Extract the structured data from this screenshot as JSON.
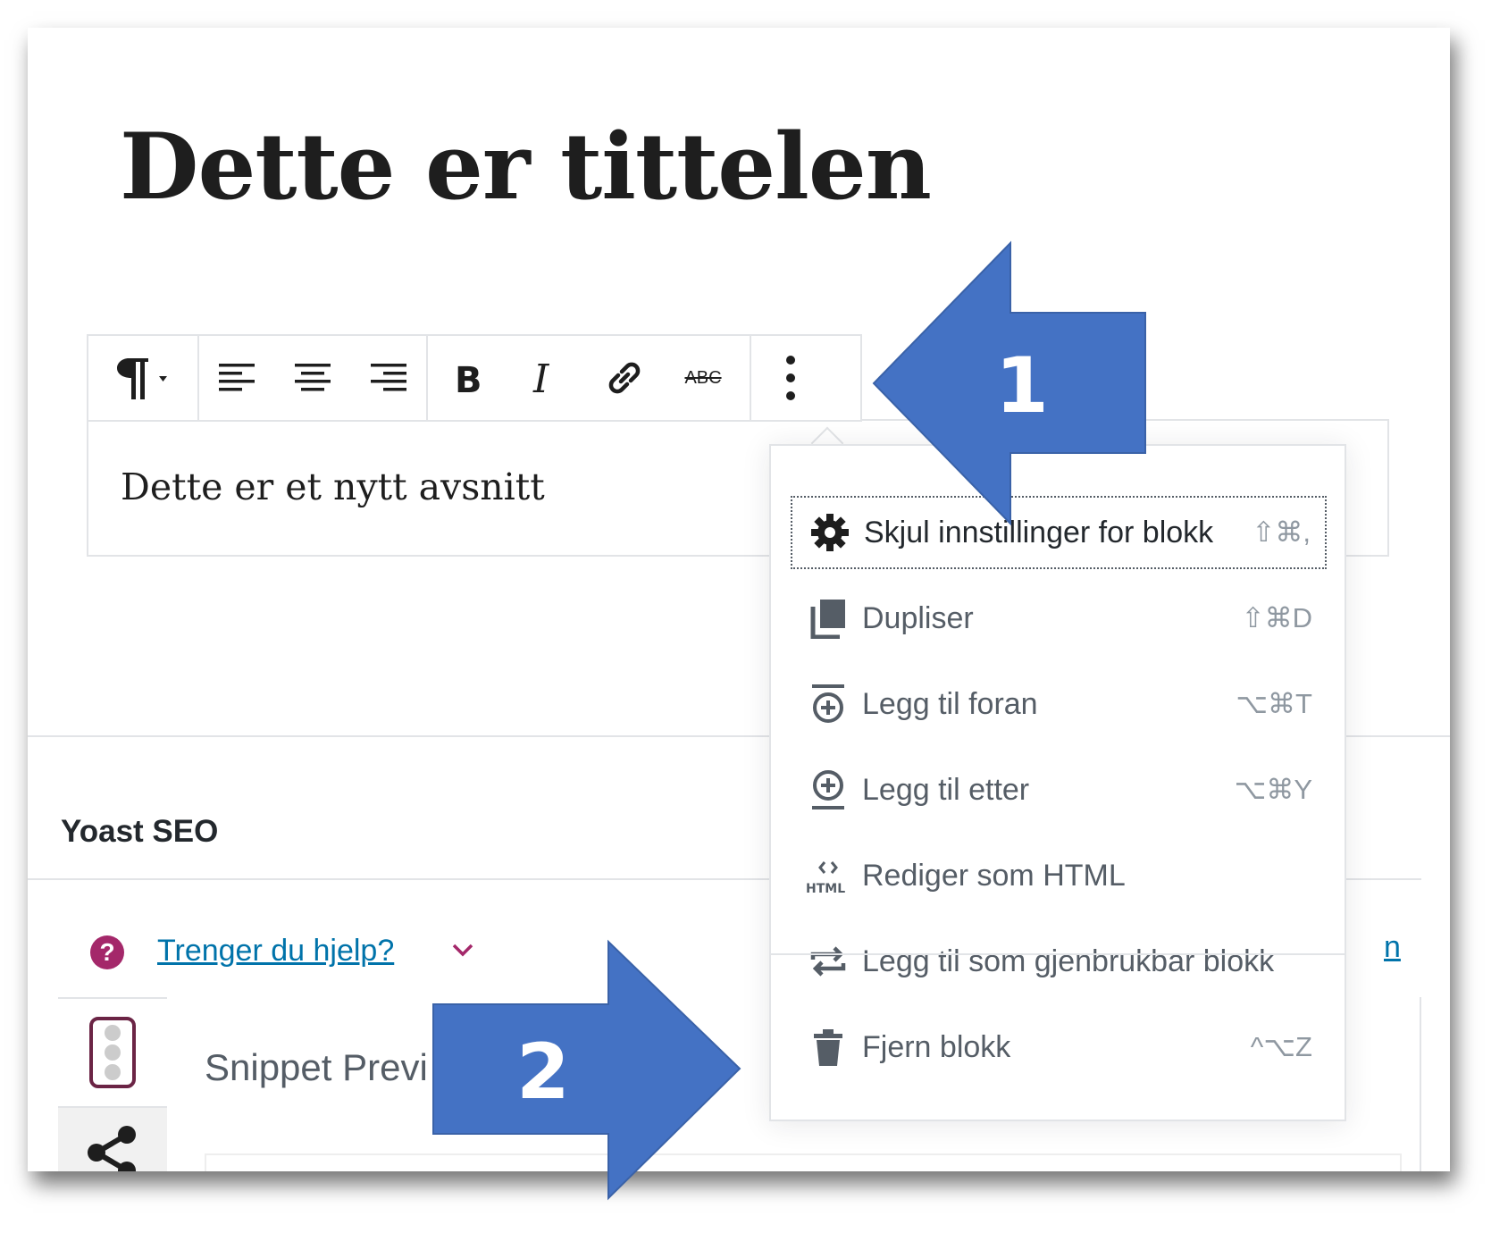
{
  "post": {
    "title": "Dette er tittelen",
    "paragraph": "Dette er et nytt avsnitt"
  },
  "toolbar": {
    "buttons": [
      "paragraph-icon",
      "align-left-icon",
      "align-center-icon",
      "align-right-icon",
      "bold-icon",
      "italic-icon",
      "link-icon",
      "strikethrough-icon",
      "more-options-icon"
    ],
    "strikethrough_glyph": "ABC"
  },
  "menu": {
    "items": [
      {
        "label": "Skjul innstillinger for blokk",
        "shortcut": "⇧⌘,",
        "icon": "gear-icon"
      },
      {
        "label": "Dupliser",
        "shortcut": "⇧⌘D",
        "icon": "duplicate-icon"
      },
      {
        "label": "Legg til foran",
        "shortcut": "⌥⌘T",
        "icon": "insert-before-icon"
      },
      {
        "label": "Legg til etter",
        "shortcut": "⌥⌘Y",
        "icon": "insert-after-icon"
      },
      {
        "label": "Rediger som HTML",
        "shortcut": "",
        "icon": "html-icon"
      },
      {
        "label": "Legg til som gjenbrukbar blokk",
        "shortcut": "",
        "icon": "reusable-icon"
      },
      {
        "label": "Fjern blokk",
        "shortcut": "^⌥Z",
        "icon": "trash-icon"
      }
    ]
  },
  "yoast": {
    "title": "Yoast SEO",
    "help_link": "Trenger du hjelp?",
    "help_glyph": "?",
    "snippet_label": "Snippet Previ"
  },
  "callouts": {
    "arrow_1": "1",
    "arrow_2": "2",
    "color": "#4472c4"
  }
}
